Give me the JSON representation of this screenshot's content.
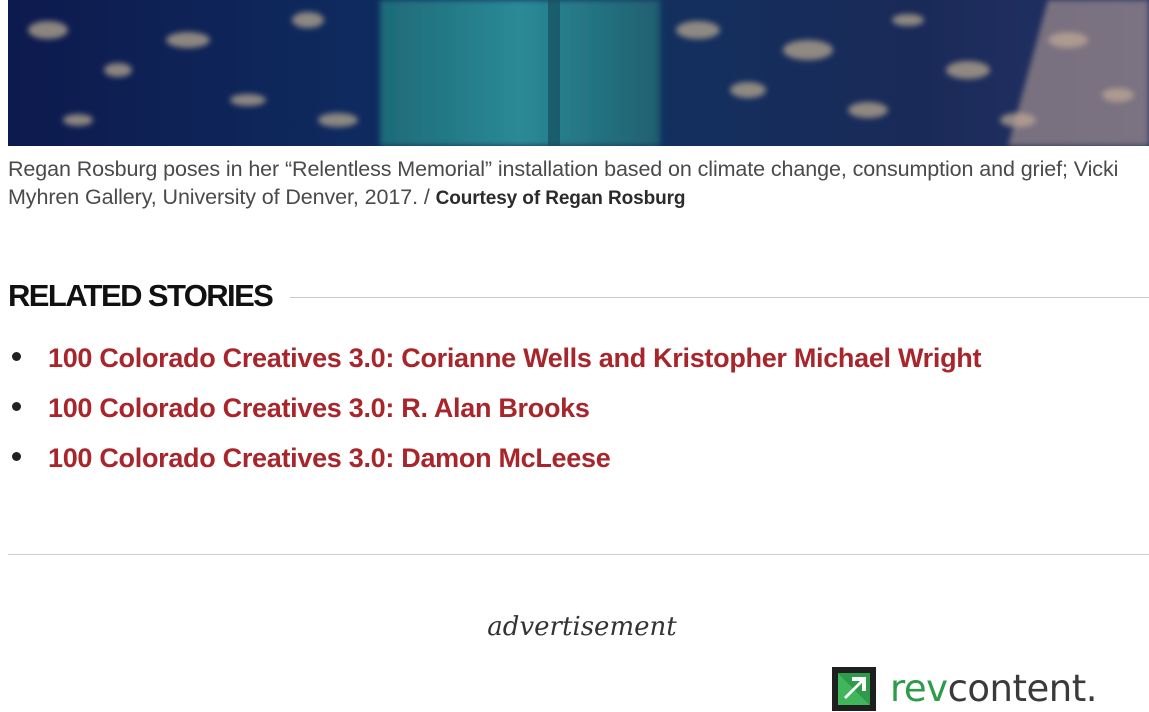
{
  "caption": {
    "text": "Regan Rosburg poses in her “Relentless Memorial” installation based on climate change, consumption and grief; Vicki Myhren Gallery, University of Denver, 2017. / ",
    "credit": "Courtesy of Regan Rosburg"
  },
  "related": {
    "title": "RELATED STORIES",
    "items": [
      {
        "label": "100 Colorado Creatives 3.0: Corianne Wells and Kristopher Michael Wright"
      },
      {
        "label": "100 Colorado Creatives 3.0: R. Alan Brooks"
      },
      {
        "label": "100 Colorado Creatives 3.0: Damon McLeese"
      }
    ]
  },
  "ad": {
    "label": "advertisement",
    "brand_rev": "rev",
    "brand_content": "content."
  },
  "colors": {
    "link_red": "#a8262b",
    "brand_green": "#2e9b4a"
  }
}
